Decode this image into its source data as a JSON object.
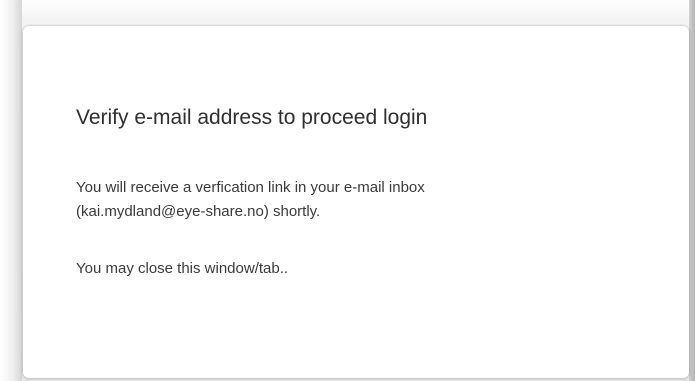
{
  "dialog": {
    "title": "Verify e-mail address to proceed login",
    "message_line1": "You will receive a verfication link in your e-mail inbox",
    "message_line2": "(kai.mydland@eye-share.no) shortly.",
    "note": "You may close this window/tab.."
  }
}
